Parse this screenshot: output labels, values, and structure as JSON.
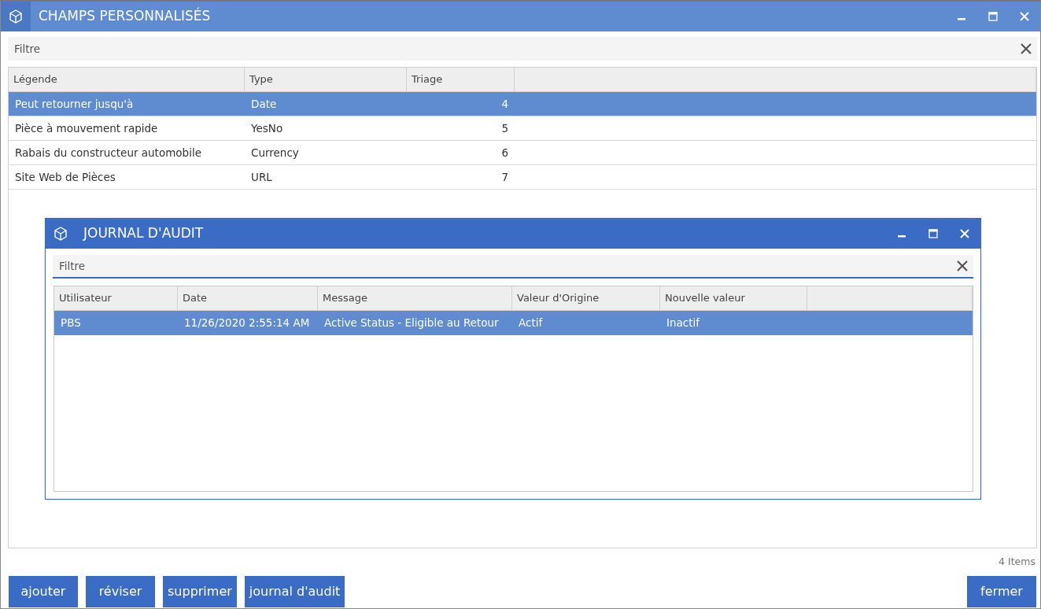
{
  "window": {
    "title": "CHAMPS PERSONNALISÉS"
  },
  "filter": {
    "placeholder": "Filtre"
  },
  "table": {
    "columns": [
      "Légende",
      "Type",
      "Triage"
    ],
    "rows": [
      {
        "cells": [
          "Peut retourner jusqu'à",
          "Date",
          "4"
        ],
        "selected": true
      },
      {
        "cells": [
          "Pièce à mouvement rapide",
          "YesNo",
          "5"
        ],
        "selected": false
      },
      {
        "cells": [
          "Rabais du constructeur automobile",
          "Currency",
          "6"
        ],
        "selected": false
      },
      {
        "cells": [
          "Site Web de Pièces",
          "URL",
          "7"
        ],
        "selected": false
      }
    ]
  },
  "audit_dialog": {
    "title": "JOURNAL D'AUDIT",
    "filter": {
      "placeholder": "Filtre"
    },
    "columns": [
      "Utilisateur",
      "Date",
      "Message",
      "Valeur d'Origine",
      "Nouvelle valeur"
    ],
    "rows": [
      {
        "cells": [
          "PBS",
          "11/26/2020 2:55:14 AM",
          "Active Status - Eligible au Retour",
          "Actif",
          "Inactif"
        ],
        "selected": true
      }
    ]
  },
  "item_count": "4 Items",
  "buttons": [
    "ajouter",
    "réviser",
    "supprimer",
    "journal d'audit"
  ],
  "close_button": "fermer"
}
